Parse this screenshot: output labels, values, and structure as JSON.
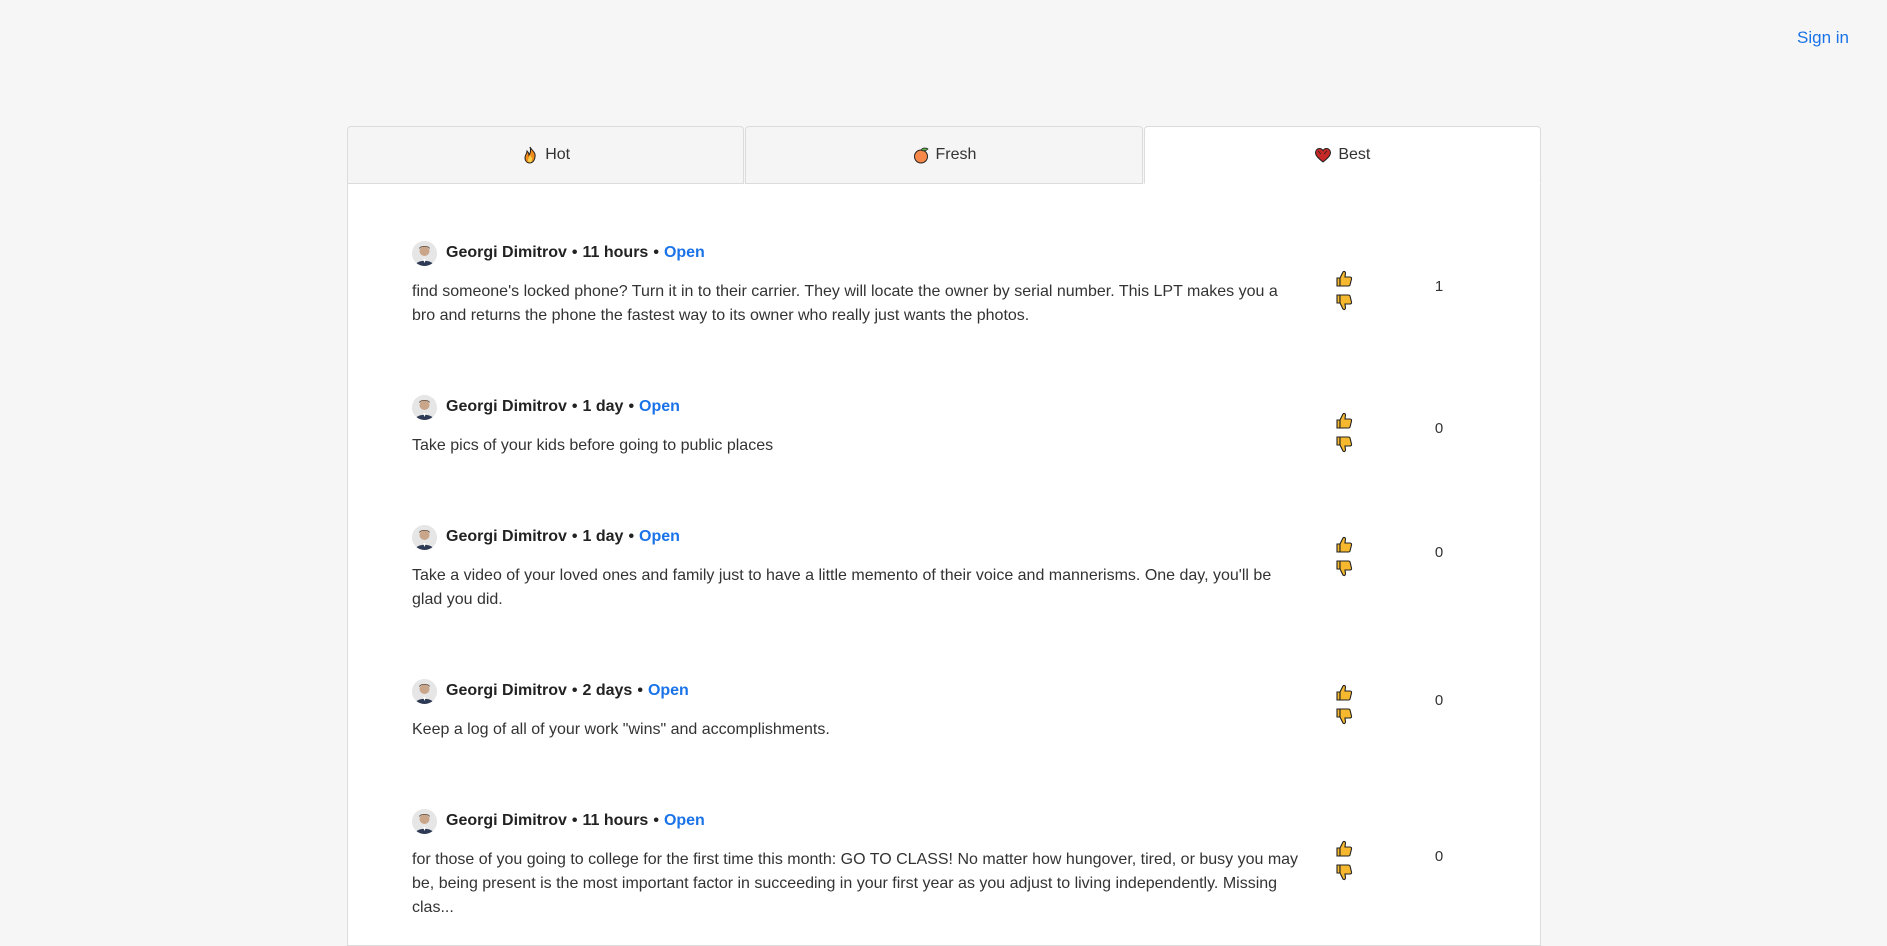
{
  "header": {
    "signin_label": "Sign in"
  },
  "tabs": [
    {
      "label": "Hot",
      "icon": "fire-icon",
      "active": false
    },
    {
      "label": "Fresh",
      "icon": "peach-icon",
      "active": false
    },
    {
      "label": "Best",
      "icon": "heart-icon",
      "active": true
    }
  ],
  "posts": [
    {
      "author": "Georgi Dimitrov",
      "time": "11 hours",
      "open_label": "Open",
      "body": "find someone's locked phone? Turn it in to their carrier. They will locate the owner by serial number. This LPT makes you a bro and returns the phone the fastest way to its owner who really just wants the photos.",
      "score": "1"
    },
    {
      "author": "Georgi Dimitrov",
      "time": "1 day",
      "open_label": "Open",
      "body": "Take pics of your kids before going to public places",
      "score": "0"
    },
    {
      "author": "Georgi Dimitrov",
      "time": "1 day",
      "open_label": "Open",
      "body": "Take a video of your loved ones and family just to have a little memento of their voice and mannerisms. One day, you'll be glad you did.",
      "score": "0"
    },
    {
      "author": "Georgi Dimitrov",
      "time": "2 days",
      "open_label": "Open",
      "body": "Keep a log of all of your work \"wins\" and accomplishments.",
      "score": "0"
    },
    {
      "author": "Georgi Dimitrov",
      "time": "11 hours",
      "open_label": "Open",
      "body": "for those of you going to college for the first time this month: GO TO CLASS! No matter how hungover, tired, or busy you may be, being present is the most important factor in succeeding in your first year as you adjust to living independently. Missing clas...",
      "score": "0"
    }
  ],
  "colors": {
    "accent": "#1a73e8",
    "thumb": "#f5b82e"
  }
}
